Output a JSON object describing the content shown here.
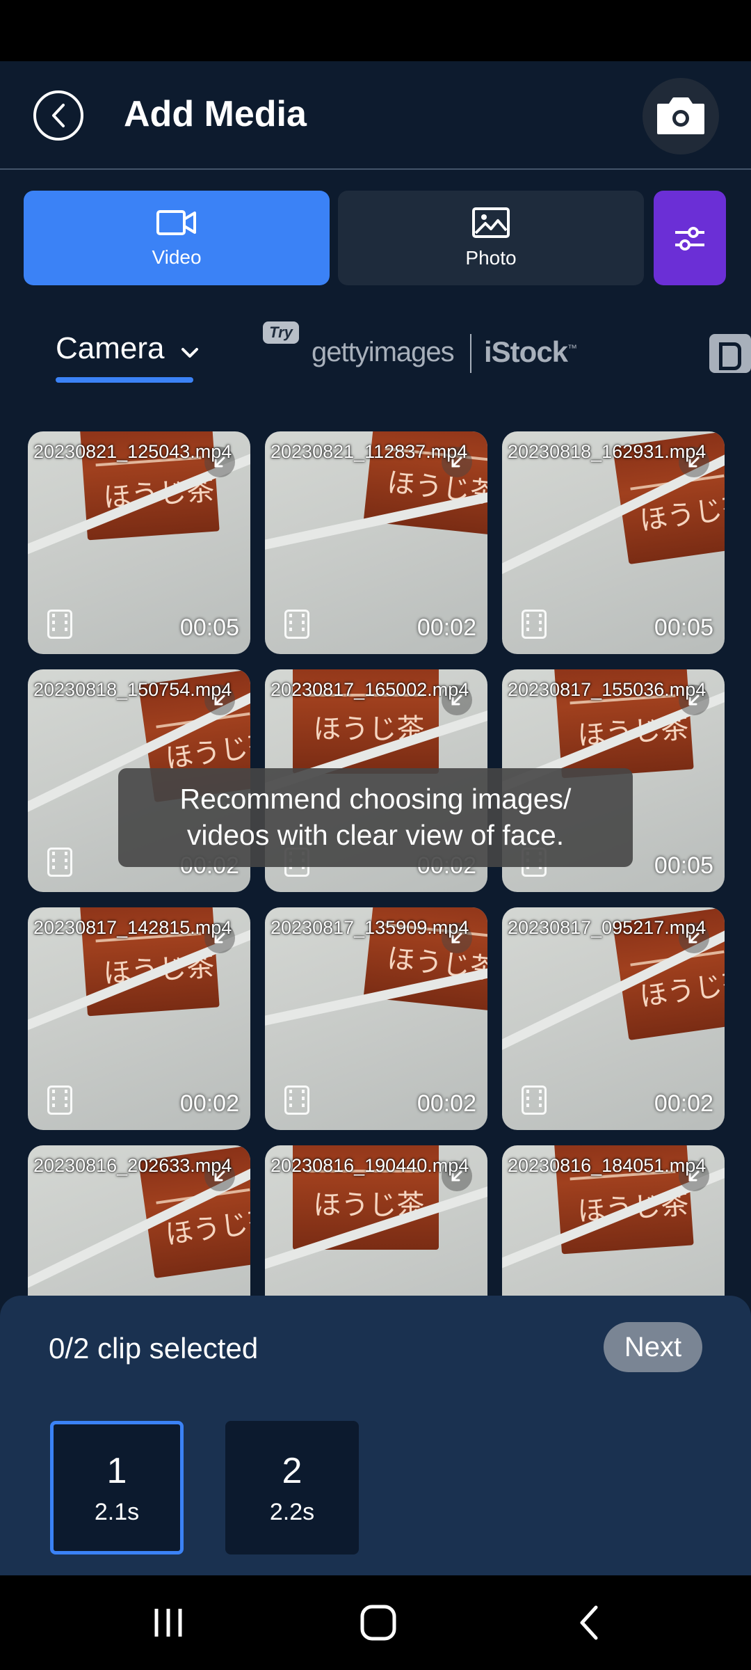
{
  "header": {
    "title": "Add Media",
    "back_icon": "back-chevron-circle-icon",
    "camera_icon": "camera-icon"
  },
  "media_types": [
    {
      "label": "Video",
      "icon": "video-icon",
      "selected": true
    },
    {
      "label": "Photo",
      "icon": "image-icon",
      "selected": false
    }
  ],
  "filter_icon": "sliders-icon",
  "sources": {
    "camera_label": "Camera",
    "try_badge": "Try",
    "getty_logo": "gettyimages",
    "istock_logo": "iStock",
    "istock_tm": "™"
  },
  "media_items": [
    {
      "name": "20230821_125043.mp4",
      "duration": "00:05"
    },
    {
      "name": "20230821_112837.mp4",
      "duration": "00:02"
    },
    {
      "name": "20230818_162931.mp4",
      "duration": "00:05"
    },
    {
      "name": "20230818_150754.mp4",
      "duration": "00:02"
    },
    {
      "name": "20230817_165002.mp4",
      "duration": "00:02"
    },
    {
      "name": "20230817_155036.mp4",
      "duration": "00:05"
    },
    {
      "name": "20230817_142815.mp4",
      "duration": "00:02"
    },
    {
      "name": "20230817_135909.mp4",
      "duration": "00:02"
    },
    {
      "name": "20230817_095217.mp4",
      "duration": "00:02"
    },
    {
      "name": "20230816_202633.mp4",
      "duration": ""
    },
    {
      "name": "20230816_190440.mp4",
      "duration": ""
    },
    {
      "name": "20230816_184051.mp4",
      "duration": ""
    }
  ],
  "toast": {
    "line1": "Recommend choosing images/",
    "line2": "videos with clear view of face."
  },
  "selection": {
    "count_text": "0/2 clip selected",
    "next_label": "Next",
    "slots": [
      {
        "number": "1",
        "length": "2.1s",
        "active": true
      },
      {
        "number": "2",
        "length": "2.2s",
        "active": false
      }
    ]
  },
  "colors": {
    "accent": "#3b82f6",
    "filter_purple": "#6b2fd6",
    "background": "#0d1b2e",
    "panel": "#1a3150"
  }
}
